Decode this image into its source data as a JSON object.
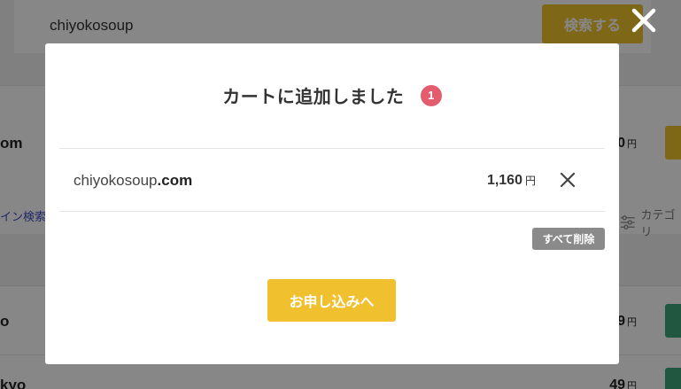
{
  "search": {
    "value": "chiyokosoup",
    "button_label": "検索する"
  },
  "background_rows": [
    {
      "domain_fragment": "om",
      "price_fragment": "0",
      "unit": "円"
    },
    {
      "domain_fragment": "o",
      "price_fragment": "9",
      "unit": "円"
    },
    {
      "domain_fragment": "kyo",
      "price_fragment": "49",
      "unit": "円"
    }
  ],
  "tools": {
    "domain_search_link": "イン検索",
    "category_filter": "カテゴリ"
  },
  "modal": {
    "title": "カートに追加しました",
    "count": "1",
    "items": [
      {
        "domain_name": "chiyokosoup",
        "tld": ".com",
        "price": "1,160",
        "unit": "円"
      }
    ],
    "delete_all_label": "すべて削除",
    "checkout_label": "お申し込みへ"
  },
  "colors": {
    "accent_yellow": "#f0c22e",
    "badge_red": "#e35d6f",
    "delete_gray": "#8a8a8a",
    "link_blue": "#3b4cc7",
    "green_button": "#3fa47a"
  },
  "icons": {
    "close_overlay": "close-icon",
    "remove_item": "close-icon",
    "filter": "filter-sliders-icon"
  }
}
